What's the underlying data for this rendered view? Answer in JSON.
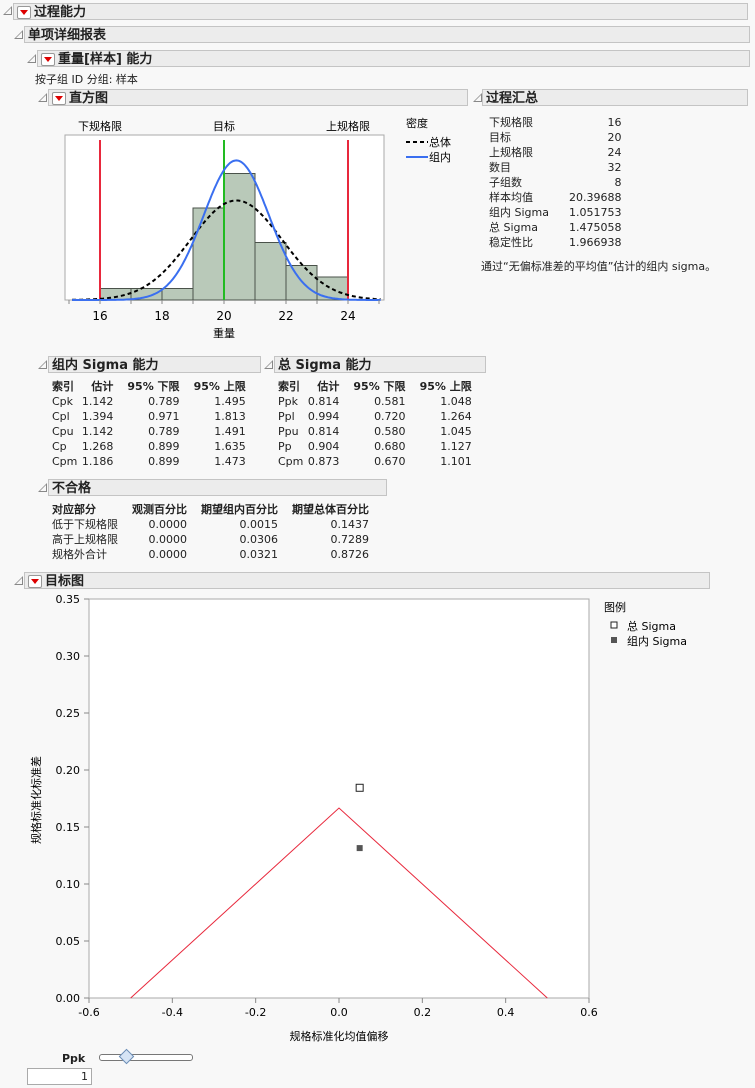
{
  "titles": {
    "process_capability": "过程能力",
    "individual_report": "单项详细报表",
    "weight_capability": "重量[样本] 能力",
    "grouping": "按子组 ID 分组: 样本",
    "histogram": "直方图",
    "summary": "过程汇总",
    "within_cap": "组内 Sigma 能力",
    "overall_cap": "总 Sigma 能力",
    "nonconformance": "不合格",
    "target_plot": "目标图"
  },
  "histogram_labels": {
    "lsl": "下规格限",
    "target": "目标",
    "usl": "上规格限",
    "density": "密度",
    "overall": "总体",
    "within": "组内"
  },
  "summary": {
    "rows": [
      [
        "下规格限",
        "16"
      ],
      [
        "目标",
        "20"
      ],
      [
        "上规格限",
        "24"
      ],
      [
        "数目",
        "32"
      ],
      [
        "子组数",
        "8"
      ],
      [
        "样本均值",
        "20.39688"
      ],
      [
        "组内 Sigma",
        "1.051753"
      ],
      [
        "总 Sigma",
        "1.475058"
      ],
      [
        "稳定性比",
        "1.966938"
      ]
    ],
    "note": "通过“无偏标准差的平均值”估计的组内 sigma。"
  },
  "within_table": {
    "headers": [
      "索引",
      "估计",
      "95% 下限",
      "95% 上限"
    ],
    "rows": [
      [
        "Cpk",
        "1.142",
        "0.789",
        "1.495"
      ],
      [
        "Cpl",
        "1.394",
        "0.971",
        "1.813"
      ],
      [
        "Cpu",
        "1.142",
        "0.789",
        "1.491"
      ],
      [
        "Cp",
        "1.268",
        "0.899",
        "1.635"
      ],
      [
        "Cpm",
        "1.186",
        "0.899",
        "1.473"
      ]
    ]
  },
  "overall_table": {
    "headers": [
      "索引",
      "估计",
      "95% 下限",
      "95% 上限"
    ],
    "rows": [
      [
        "Ppk",
        "0.814",
        "0.581",
        "1.048"
      ],
      [
        "Ppl",
        "0.994",
        "0.720",
        "1.264"
      ],
      [
        "Ppu",
        "0.814",
        "0.580",
        "1.045"
      ],
      [
        "Pp",
        "0.904",
        "0.680",
        "1.127"
      ],
      [
        "Cpm",
        "0.873",
        "0.670",
        "1.101"
      ]
    ]
  },
  "nonconf_table": {
    "headers": [
      "对应部分",
      "观测百分比",
      "期望组内百分比",
      "期望总体百分比"
    ],
    "rows": [
      [
        "低于下规格限",
        "0.0000",
        "0.0015",
        "0.1437"
      ],
      [
        "高于上规格限",
        "0.0000",
        "0.0306",
        "0.7289"
      ],
      [
        "规格外合计",
        "0.0000",
        "0.0321",
        "0.8726"
      ]
    ]
  },
  "target_legend": {
    "title": "图例",
    "overall": "总 Sigma",
    "within": "组内 Sigma"
  },
  "ppk": {
    "label": "Ppk",
    "value": "1",
    "slider_fraction": 0.28
  },
  "colors": {
    "spec": "#e8283c",
    "target": "#22bb22",
    "within": "#3a6ff0",
    "bar": "#b9c9b9"
  },
  "chart_data": [
    {
      "type": "bar",
      "title": "直方图",
      "xlabel": "重量",
      "bins": [
        [
          16,
          17
        ],
        [
          17,
          18
        ],
        [
          18,
          19
        ],
        [
          19,
          20
        ],
        [
          20,
          21
        ],
        [
          21,
          22
        ],
        [
          22,
          23
        ],
        [
          23,
          24
        ]
      ],
      "values": [
        1,
        1,
        1,
        8,
        11,
        5,
        3,
        2
      ],
      "xlim": [
        15.1,
        25.1
      ],
      "xticks": [
        "16",
        "18",
        "20",
        "22",
        "24"
      ],
      "lsl": 16,
      "target": 20,
      "usl": 24,
      "mean": 20.39688,
      "sigma_within": 1.051753,
      "sigma_overall": 1.475058
    },
    {
      "type": "scatter",
      "title": "目标图",
      "xlabel": "规格标准化均值偏移",
      "ylabel": "规格标准化标准差",
      "xlim": [
        -0.6,
        0.6
      ],
      "ylim": [
        0,
        0.35
      ],
      "xticks": [
        "-0.6",
        "-0.4",
        "-0.2",
        "0.0",
        "0.2",
        "0.4",
        "0.6"
      ],
      "yticks": [
        "0.00",
        "0.05",
        "0.10",
        "0.15",
        "0.20",
        "0.25",
        "0.30",
        "0.35"
      ],
      "points": [
        {
          "name": "总 Sigma",
          "x": 0.0496,
          "y": 0.1844
        },
        {
          "name": "组内 Sigma",
          "x": 0.0496,
          "y": 0.1315
        }
      ],
      "ppk_boundary": 1
    }
  ]
}
